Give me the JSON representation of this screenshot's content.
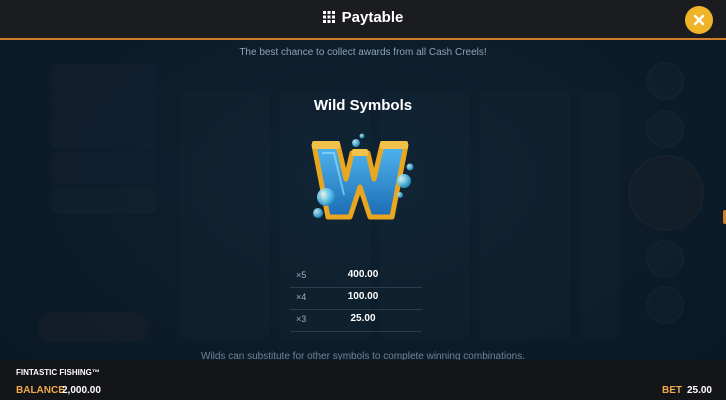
{
  "header": {
    "title": "Paytable",
    "menu_icon": "grid-icon",
    "close_icon": "close-icon",
    "accent_color": "#d07e2a",
    "close_button_color": "#f0b428"
  },
  "subtitle": "The best chance to collect awards from all Cash Creels!",
  "section": {
    "title": "Wild Symbols",
    "symbol_icon": "wild-w-icon"
  },
  "paytable": [
    {
      "multiplier": "×5",
      "value": "400.00"
    },
    {
      "multiplier": "×4",
      "value": "100.00"
    },
    {
      "multiplier": "×3",
      "value": "25.00"
    }
  ],
  "footnote": "Wilds can substitute for other symbols to complete winning combinations.",
  "footer": {
    "game_name": "FINTASTIC FISHING™",
    "balance_label": "BALANCE",
    "balance_value": "2,000.00",
    "bet_label": "BET",
    "bet_value": "25.00",
    "label_color": "#f0a94a"
  }
}
